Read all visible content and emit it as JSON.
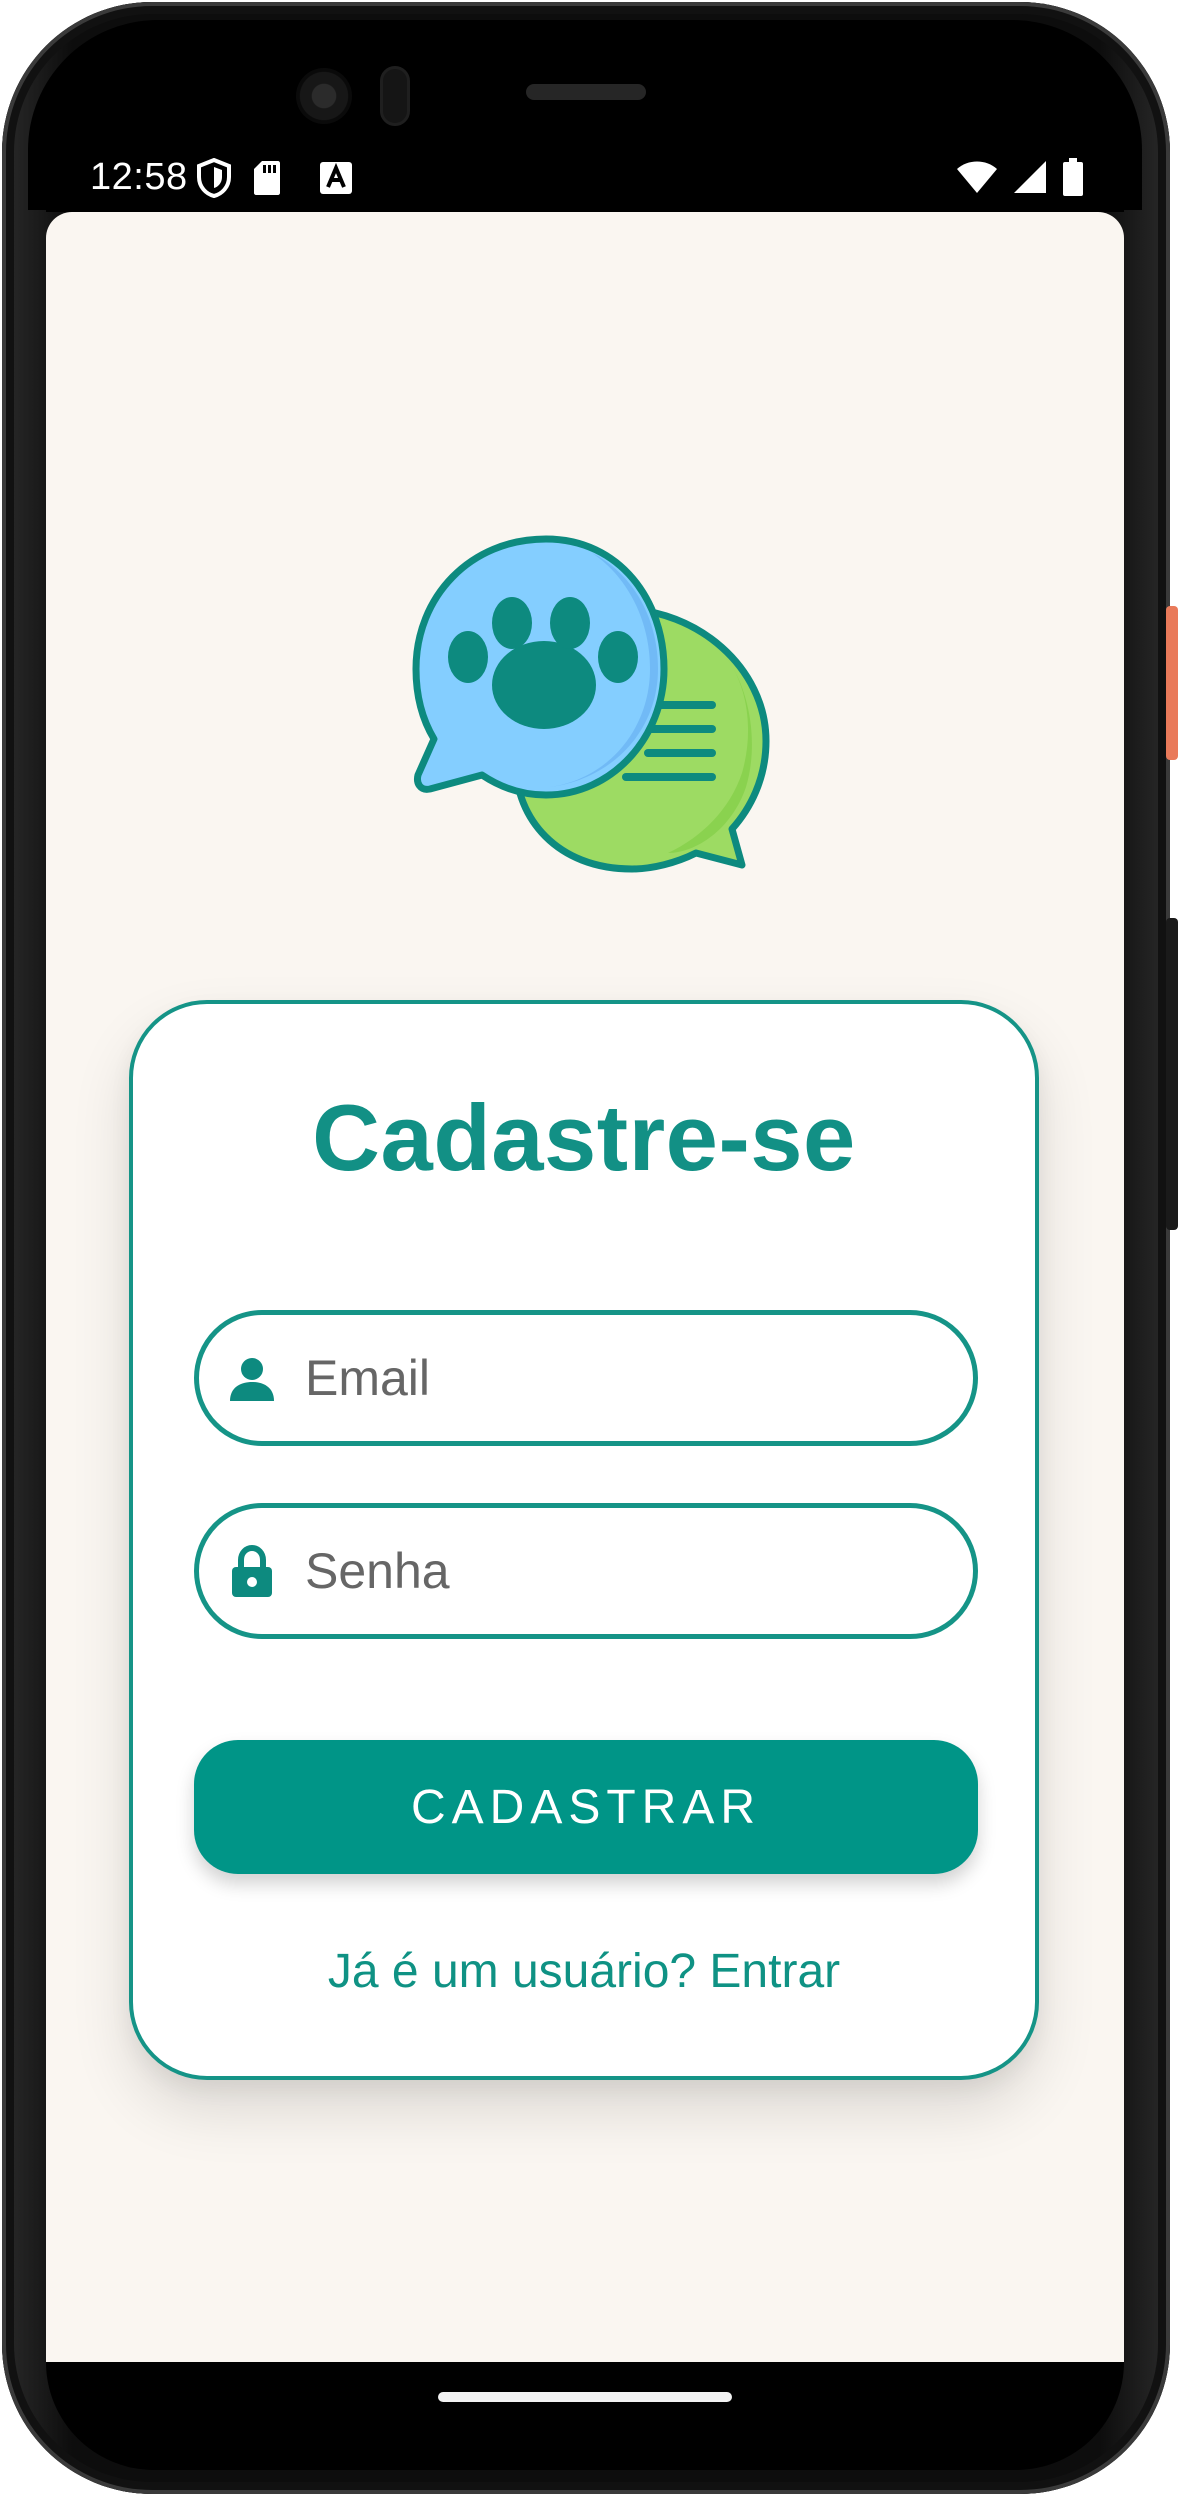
{
  "status_bar": {
    "time": "12:58",
    "left_icons": [
      "shield-icon",
      "sd-card-icon",
      "text-a-icon"
    ],
    "right_icons": [
      "wifi-icon",
      "cell-signal-icon",
      "battery-icon"
    ]
  },
  "logo": {
    "icon": "paw-chat-bubbles-icon"
  },
  "card": {
    "title": "Cadastre-se",
    "email": {
      "placeholder": "Email",
      "value": "",
      "icon": "person-icon"
    },
    "senha": {
      "placeholder": "Senha",
      "value": "",
      "icon": "lock-icon"
    },
    "submit_label": "CADASTRAR",
    "login_link": "Já é um usuário? Entrar"
  },
  "colors": {
    "accent": "#009587",
    "title": "#129085",
    "background": "#faf6f1",
    "card": "#ffffff",
    "bubble_blue": "#82cfff",
    "bubble_green": "#8dd85c"
  }
}
